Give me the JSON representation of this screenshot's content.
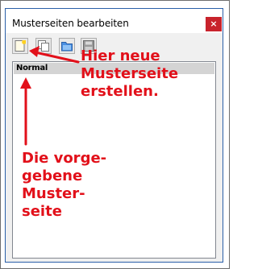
{
  "window": {
    "title": "Musterseiten bearbeiten",
    "close_glyph": "×"
  },
  "toolbar": {
    "buttons": [
      {
        "icon": "new-page-icon"
      },
      {
        "icon": "duplicate-page-icon"
      },
      {
        "icon": "import-folder-icon"
      },
      {
        "icon": "save-page-icon"
      }
    ]
  },
  "list": {
    "items": [
      "Normal"
    ]
  },
  "annotations": {
    "create_hint": [
      "Hier neue",
      "Musterseite",
      "erstellen."
    ],
    "default_hint": [
      "Die vorge-",
      "gebene",
      "Muster-",
      "seite"
    ],
    "color": "#e2101a"
  }
}
